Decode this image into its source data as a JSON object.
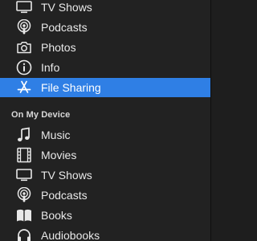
{
  "sidebar": {
    "items_top": [
      {
        "label": "TV Shows",
        "icon": "tv-icon"
      },
      {
        "label": "Podcasts",
        "icon": "podcast-icon"
      },
      {
        "label": "Photos",
        "icon": "camera-icon"
      },
      {
        "label": "Info",
        "icon": "info-icon"
      },
      {
        "label": "File Sharing",
        "icon": "app-store-icon",
        "selected": true
      }
    ],
    "section_header": "On My Device",
    "items_device": [
      {
        "label": "Music",
        "icon": "music-note-icon"
      },
      {
        "label": "Movies",
        "icon": "film-icon"
      },
      {
        "label": "TV Shows",
        "icon": "tv-icon"
      },
      {
        "label": "Podcasts",
        "icon": "podcast-icon"
      },
      {
        "label": "Books",
        "icon": "book-icon"
      },
      {
        "label": "Audiobooks",
        "icon": "headphones-icon"
      }
    ]
  },
  "colors": {
    "background": "#222222",
    "selection": "#2f7fe5",
    "text": "#e8e8e8"
  }
}
